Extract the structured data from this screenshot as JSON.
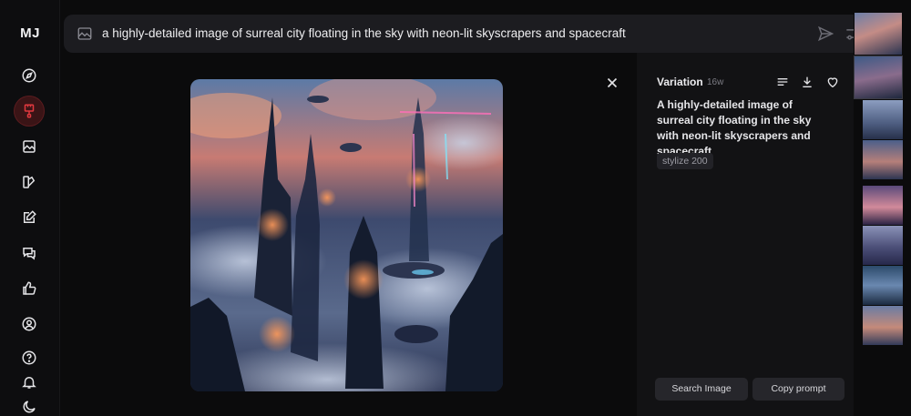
{
  "app": {
    "logo": "MJ"
  },
  "sidebar": {
    "items": [
      {
        "name": "explore",
        "icon": "compass-icon"
      },
      {
        "name": "create",
        "icon": "brush-icon",
        "active": true
      },
      {
        "name": "organize",
        "icon": "image-icon"
      },
      {
        "name": "edit",
        "icon": "palette-icon"
      },
      {
        "name": "personalize",
        "icon": "edit-icon"
      },
      {
        "name": "chat",
        "icon": "chat-icon"
      },
      {
        "name": "rate",
        "icon": "thumbs-up-icon"
      },
      {
        "name": "account",
        "icon": "user-circle-icon"
      },
      {
        "name": "help",
        "icon": "help-icon"
      },
      {
        "name": "notifications",
        "icon": "bell-icon"
      },
      {
        "name": "theme",
        "icon": "moon-icon"
      }
    ]
  },
  "prompt_bar": {
    "text": "a highly-detailed image of surreal city floating in the sky with neon-lit skyscrapers and spacecraft"
  },
  "details": {
    "title": "Variation",
    "age": "16w",
    "prompt": "A highly-detailed image of surreal city floating in the sky with neon-lit skyscrapers and spacecraft",
    "chip": "stylize 200",
    "search_button": "Search Image",
    "copy_button": "Copy prompt"
  },
  "colors": {
    "background": "#0b0b0c",
    "panel": "#121214",
    "prompt_bar": "#1c1c20",
    "active_nav": "#3a1416",
    "accent_red": "#e0383e"
  }
}
